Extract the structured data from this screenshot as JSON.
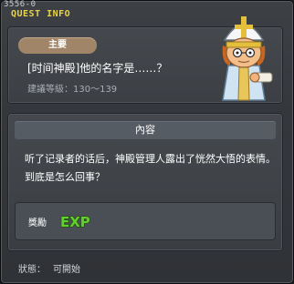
{
  "window": {
    "quest_id": "3556-0",
    "title": "QUEST INFO"
  },
  "quest": {
    "category": "主要",
    "name": "[时间神殿]他的名字是……？",
    "recommended_level": "建議等級：130～139"
  },
  "content": {
    "header": "內容",
    "description": "听了记录者的话后，神殿管理人露出了恍然大悟的表情。到底是怎么回事？"
  },
  "reward": {
    "label": "獎勵",
    "exp_icon": "EXP"
  },
  "status": {
    "label": "狀態：",
    "value": "可開始"
  },
  "icons": [
    "npc-temple-keeper-icon",
    "exp-icon"
  ],
  "colors": {
    "title": "#e8d44a",
    "category_pill": "#a08569",
    "exp_green": "#5fd12b"
  }
}
